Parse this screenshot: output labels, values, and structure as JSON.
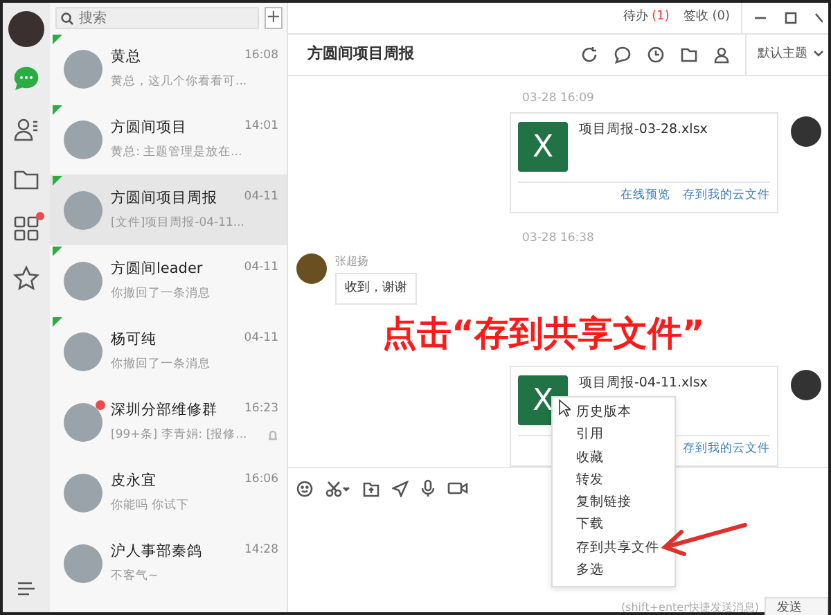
{
  "rail": {
    "items": [
      {
        "kind": "avatar",
        "selected": false,
        "dot": false
      },
      {
        "kind": "chat",
        "selected": true,
        "dot": false
      },
      {
        "kind": "contacts",
        "selected": false,
        "dot": false
      },
      {
        "kind": "folder",
        "selected": false,
        "dot": false
      },
      {
        "kind": "apps",
        "selected": false,
        "dot": true
      },
      {
        "kind": "star",
        "selected": false,
        "dot": false
      },
      {
        "kind": "menu",
        "selected": false,
        "dot": false
      }
    ]
  },
  "search": {
    "placeholder": "搜索"
  },
  "add_button": "+",
  "chats": [
    {
      "name": "黄总",
      "time": "16:08",
      "preview": "黄总，这几个你看看可...",
      "pinned": true,
      "selected": false,
      "unread": false,
      "muted": false
    },
    {
      "name": "方圆间项目",
      "time": "14:01",
      "preview": "黄总: 主题管理是放在...",
      "pinned": true,
      "selected": false,
      "unread": false,
      "muted": false
    },
    {
      "name": "方圆间项目周报",
      "time": "04-11",
      "preview": "[文件]项目周报-04-11...",
      "pinned": true,
      "selected": true,
      "unread": false,
      "muted": false
    },
    {
      "name": "方圆间leader",
      "time": "04-11",
      "preview": "你撤回了一条消息",
      "pinned": true,
      "selected": false,
      "unread": false,
      "muted": false
    },
    {
      "name": "杨可纯",
      "time": "04-11",
      "preview": "你撤回了一条消息",
      "pinned": true,
      "selected": false,
      "unread": false,
      "muted": false
    },
    {
      "name": "深圳分部维修群",
      "time": "16:23",
      "preview": "[99+条] 李青娟: [报修...",
      "pinned": false,
      "selected": false,
      "unread": true,
      "muted": true
    },
    {
      "name": "皮永宜",
      "time": "16:06",
      "preview": "你能吗 你试下",
      "pinned": false,
      "selected": false,
      "unread": false,
      "muted": false
    },
    {
      "name": "沪人事部秦鸽",
      "time": "14:28",
      "preview": "不客气~",
      "pinned": false,
      "selected": false,
      "unread": false,
      "muted": false
    }
  ],
  "top_bar": {
    "todo_label": "待办",
    "todo_count": "(1)",
    "sign_label": "签收 (0)"
  },
  "chat_title": "方圆间项目周报",
  "theme_select": "默认主题",
  "messages": [
    {
      "kind": "time",
      "text": "03-28 16:09"
    },
    {
      "kind": "file",
      "file_name": "项目周报-03-28.xlsx",
      "icon_letter": "X",
      "actions": [
        "在线预览",
        "存到我的云文件"
      ]
    },
    {
      "kind": "time",
      "text": "03-28 16:38"
    },
    {
      "kind": "text",
      "sender": "张超扬",
      "text": "收到，谢谢"
    },
    {
      "kind": "file",
      "file_name": "项目周报-04-11.xlsx",
      "icon_letter": "X",
      "actions": [
        "存到我的云文件"
      ]
    }
  ],
  "context_menu": [
    "历史版本",
    "引用",
    "收藏",
    "转发",
    "复制链接",
    "下载",
    "存到共享文件",
    "多选"
  ],
  "input_hint": "(shift+enter快捷发送消息)",
  "send_button": "发送",
  "annotation": "点击“存到共享文件”"
}
